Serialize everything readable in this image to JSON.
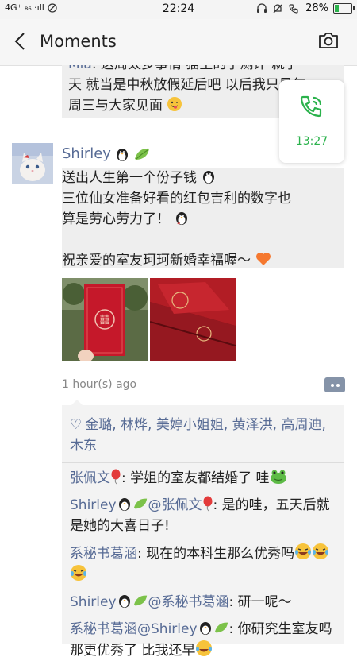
{
  "status_bar": {
    "signal": "4G⁺ ₈₆ ·ıll",
    "time": "22:24",
    "battery": "28%",
    "battery_level": 0.28
  },
  "header": {
    "title": "Moments"
  },
  "prev_post": {
    "name": "Mia",
    "line1": ": 这周太多事情 猫生的了测评 就了",
    "line2": "天 就当是中秋放假延后吧 以后我只是每",
    "line3": "周三与大家见面"
  },
  "call_widget": {
    "time": "13:27"
  },
  "post": {
    "author": "Shirley",
    "lines": [
      "送出人生第一个份子钱",
      "三位仙女准备好看的红包吉利的数字也",
      "算是劳心劳力了！",
      "",
      "祝亲爱的室友珂珂新婚幸福喔～"
    ],
    "timestamp": "1 hour(s) ago"
  },
  "likes": {
    "names": "金璐, 林烨, 美婷小姐姐, 黄泽洪, 高周迪, 木东"
  },
  "comments": [
    {
      "name": "张佩文",
      "reply_to": "",
      "text": ": 学姐的室友都结婚了 哇"
    },
    {
      "name": "Shirley",
      "reply_to": "@张佩文",
      "text": ": 是的哇，五天后就是她的大喜日子!"
    },
    {
      "name": "系秘书葛涵",
      "reply_to": "",
      "text": ": 现在的本科生那么优秀吗"
    },
    {
      "name": "Shirley",
      "reply_to": "@系秘书葛涵",
      "text": ": 研一呢～"
    },
    {
      "name": "系秘书葛涵",
      "reply_to": "@Shirley",
      "text": ": 你研究生室友吗 那更优秀了 比我还早"
    }
  ],
  "colors": {
    "link": "#576b95",
    "call_green": "#2bb24c",
    "bubble_bg": "#eeeeee"
  }
}
